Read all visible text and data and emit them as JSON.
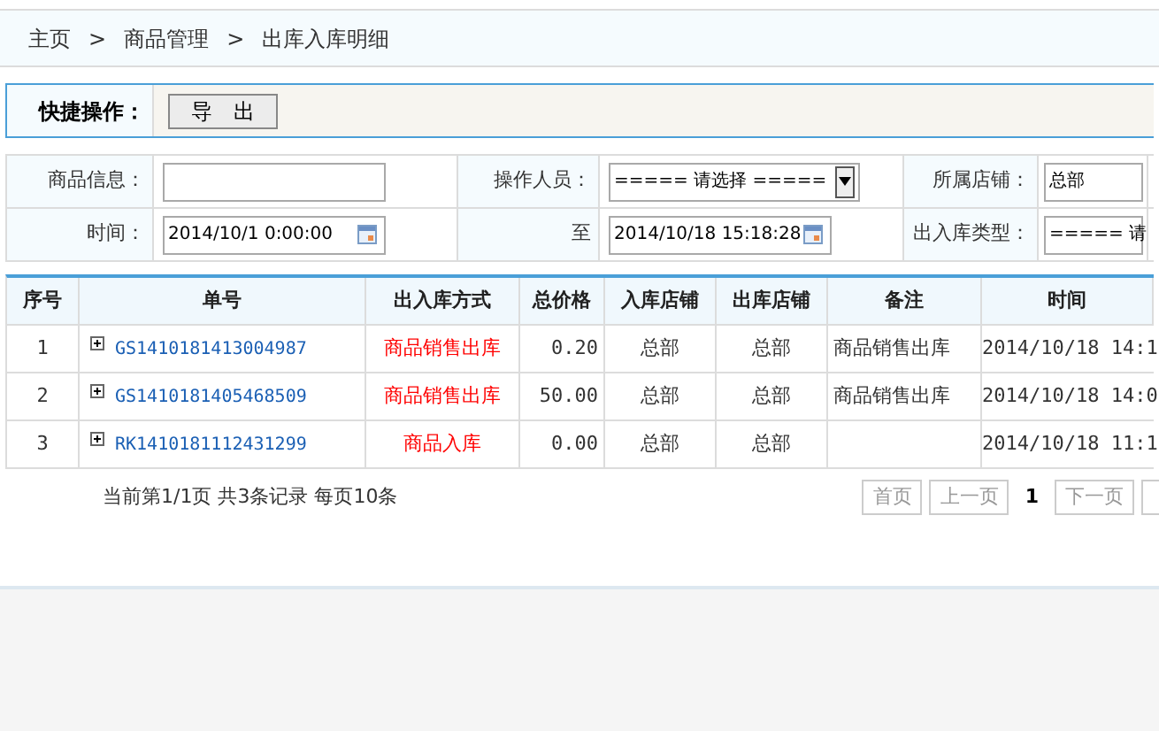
{
  "breadcrumb": [
    {
      "label": "主页"
    },
    {
      "label": "商品管理"
    },
    {
      "label": "出库入库明细"
    }
  ],
  "separator": ">",
  "toolbar": {
    "label": "快捷操作：",
    "buttons": [
      "导　出"
    ]
  },
  "filters": [
    {
      "label": "商品信息：",
      "kind": "text"
    },
    {
      "label": "操作人员：",
      "kind": "select",
      "value": "===== 请选择 ====="
    },
    {
      "label": "所属店铺：",
      "kind": "text",
      "value": "总部"
    },
    {
      "label": "时间：",
      "kind": "date",
      "value": "2014/10/1 0:00:00"
    },
    {
      "label": "至",
      "kind": "date",
      "value": "2014/10/18 15:18:28"
    },
    {
      "label": "出入库类型：",
      "kind": "text",
      "value": "===== 请"
    }
  ],
  "table": {
    "columns": [
      "序号",
      "单号",
      "出入库方式",
      "总价格",
      "入库店铺",
      "出库店铺",
      "备注",
      "时间"
    ],
    "rows": [
      {
        "index": "1",
        "number": "GS1410181413004987",
        "method": "商品销售出库",
        "total": "0.20",
        "in_store": "总部",
        "out_store": "总部",
        "note": "商品销售出库",
        "time": "2014/10/18 14:1"
      },
      {
        "index": "2",
        "number": "GS1410181405468509",
        "method": "商品销售出库",
        "total": "50.00",
        "in_store": "总部",
        "out_store": "总部",
        "note": "商品销售出库",
        "time": "2014/10/18 14:0"
      },
      {
        "index": "3",
        "number": "RK1410181112431299",
        "method": "商品入库",
        "total": "0.00",
        "in_store": "总部",
        "out_store": "总部",
        "time": "2014/10/18 11:1"
      }
    ]
  },
  "pagination": {
    "summary": "当前第1/1页 共3条记录 每页10条",
    "buttons": [
      {
        "label": "首页",
        "kind": "button"
      },
      {
        "label": "上一页",
        "kind": "button"
      },
      {
        "label": "1",
        "kind": "current"
      },
      {
        "label": "下一页",
        "kind": "button"
      }
    ]
  }
}
